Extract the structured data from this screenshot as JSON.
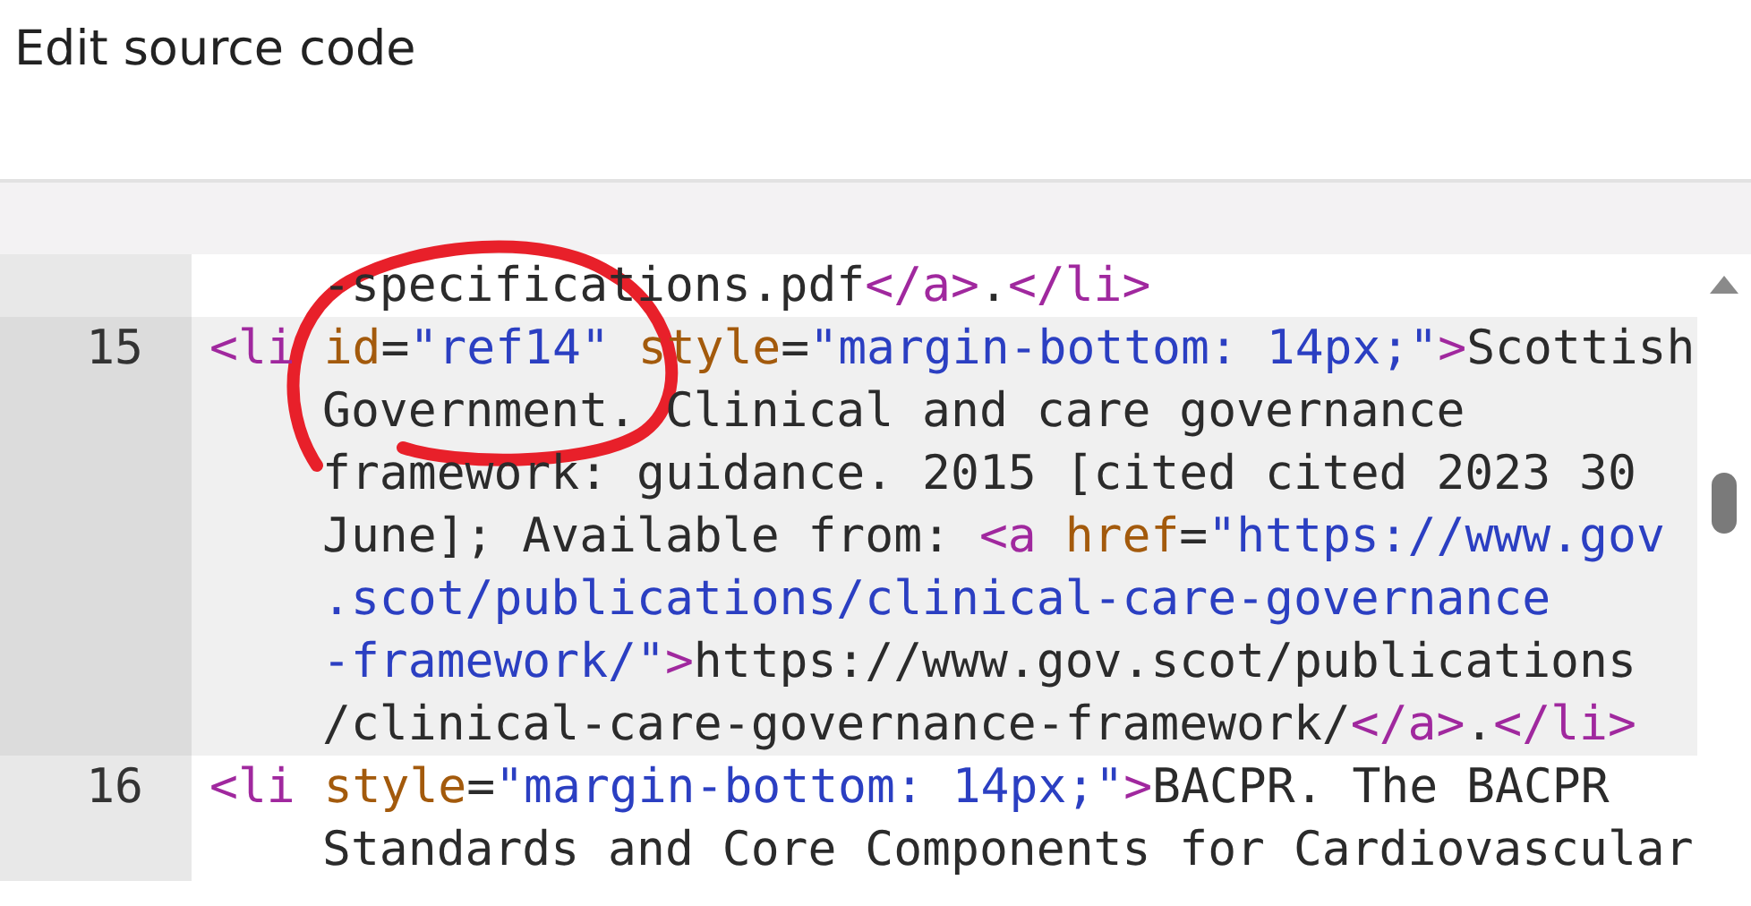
{
  "dialog": {
    "title": "Edit source code"
  },
  "editor": {
    "rows": [
      {
        "active": false,
        "tokens": [
          {
            "kind": "text",
            "text": "-specifications.pdf"
          },
          {
            "kind": "tag",
            "text": "</a>"
          },
          {
            "kind": "text",
            "text": "."
          },
          {
            "kind": "tag",
            "text": "</li>"
          }
        ]
      },
      {
        "number": "15",
        "active": true,
        "tokens": [
          {
            "kind": "tag",
            "text": "<li"
          },
          {
            "kind": "attr",
            "text": " id"
          },
          {
            "kind": "text",
            "text": "="
          },
          {
            "kind": "string",
            "text": "\"ref14\""
          },
          {
            "kind": "attr",
            "text": " style"
          },
          {
            "kind": "text",
            "text": "="
          },
          {
            "kind": "string",
            "text": "\"margin-bottom: 14px;\""
          },
          {
            "kind": "tag",
            "text": ">"
          },
          {
            "kind": "text",
            "text": "Scottish"
          }
        ]
      },
      {
        "active": true,
        "tokens": [
          {
            "kind": "text",
            "text": "Government. Clinical and care governance"
          }
        ]
      },
      {
        "active": true,
        "tokens": [
          {
            "kind": "text",
            "text": "framework: guidance. 2015 [cited cited 2023 30"
          }
        ]
      },
      {
        "active": true,
        "tokens": [
          {
            "kind": "text",
            "text": "June]; Available from: "
          },
          {
            "kind": "tag",
            "text": "<a"
          },
          {
            "kind": "attr",
            "text": " href"
          },
          {
            "kind": "text",
            "text": "="
          },
          {
            "kind": "string",
            "text": "\"https://www.gov"
          }
        ]
      },
      {
        "active": true,
        "tokens": [
          {
            "kind": "string",
            "text": ".scot/publications/clinical-care-governance"
          }
        ]
      },
      {
        "active": true,
        "tokens": [
          {
            "kind": "string",
            "text": "-framework/\""
          },
          {
            "kind": "tag",
            "text": ">"
          },
          {
            "kind": "text",
            "text": "https://www.gov.scot/publications"
          }
        ]
      },
      {
        "active": true,
        "tokens": [
          {
            "kind": "text",
            "text": "/clinical-care-governance-framework/"
          },
          {
            "kind": "tag",
            "text": "</a>"
          },
          {
            "kind": "text",
            "text": "."
          },
          {
            "kind": "tag",
            "text": "</li>"
          }
        ]
      },
      {
        "number": "16",
        "active": false,
        "tokens": [
          {
            "kind": "tag",
            "text": "<li"
          },
          {
            "kind": "attr",
            "text": " style"
          },
          {
            "kind": "text",
            "text": "="
          },
          {
            "kind": "string",
            "text": "\"margin-bottom: 14px;\""
          },
          {
            "kind": "tag",
            "text": ">"
          },
          {
            "kind": "text",
            "text": "BACPR. The BACPR"
          }
        ]
      },
      {
        "active": false,
        "tokens": [
          {
            "kind": "text",
            "text": "Standards and Core Components for Cardiovascular"
          }
        ]
      }
    ]
  }
}
